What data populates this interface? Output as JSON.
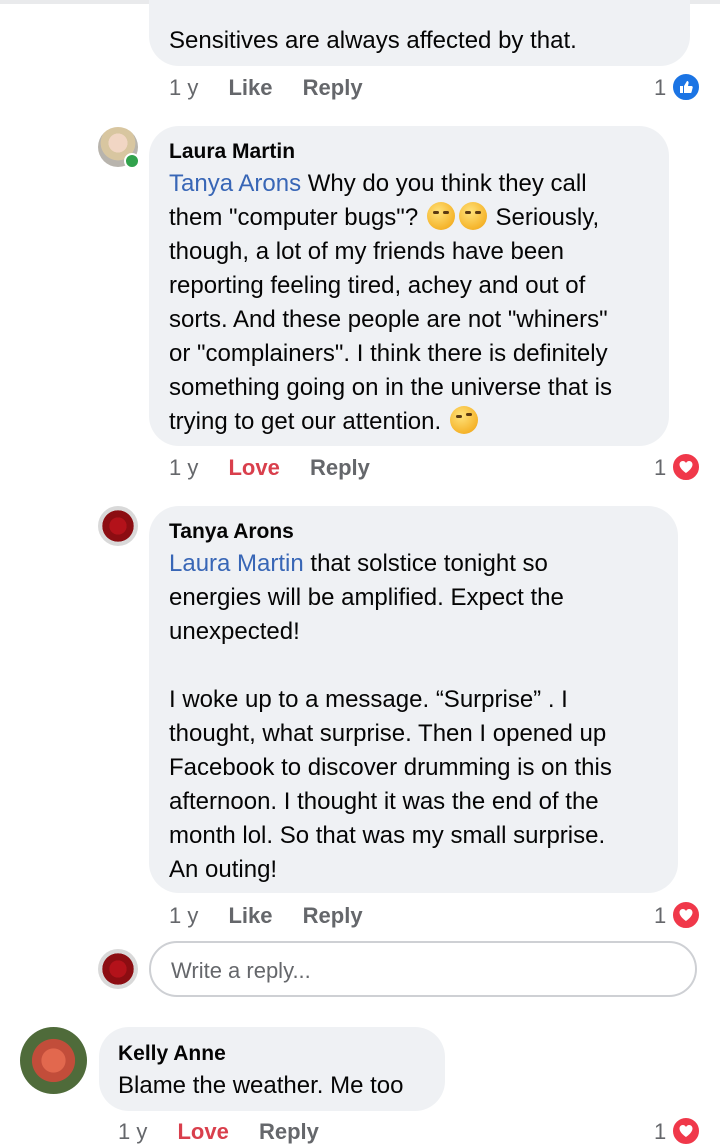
{
  "comments": [
    {
      "text": "Sensitives are always affected by that.",
      "time": "1 y",
      "action1": "Like",
      "action2": "Reply",
      "reaction_count": "1",
      "reaction_icon": "like-icon"
    },
    {
      "author": "Laura Martin",
      "mention": "Tanya Arons",
      "text_lines": [
        " Why do you think they call",
        "them \"computer bugs\"? ",
        "though, a lot of my friends have been",
        "reporting feeling tired, achey and out of",
        "sorts. And these people are not \"whiners\"",
        "or \"complainers\". I think there is definitely",
        "something going on in the universe that is",
        "trying to get our attention. "
      ],
      "after_emoji": " Seriously,",
      "time": "1 y",
      "action1": "Love",
      "action2": "Reply",
      "reaction_count": "1",
      "reaction_icon": "heart-icon"
    },
    {
      "author": "Tanya Arons",
      "mention": "Laura Martin",
      "text_lines": [
        " that solstice tonight so",
        "energies will be amplified.  Expect the",
        "unexpected!",
        "",
        "I woke up to a message.  “Surprise” .  I",
        "thought,  what surprise.  Then I opened up",
        "Facebook to discover drumming is on this",
        "afternoon.  I thought it was the end of the",
        "month lol.  So that was my small surprise.",
        "An outing!"
      ],
      "time": "1 y",
      "action1": "Like",
      "action2": "Reply",
      "reaction_count": "1",
      "reaction_icon": "heart-icon"
    },
    {
      "author": "Kelly Anne",
      "text": "Blame the weather. Me too",
      "time": "1 y",
      "action1": "Love",
      "action2": "Reply",
      "reaction_count": "1",
      "reaction_icon": "heart-icon"
    }
  ],
  "reply_input": {
    "placeholder": "Write a reply..."
  },
  "colors": {
    "mention": "#3866b6",
    "love": "#d93f4c",
    "bubble": "#eff1f4",
    "like_blue": "#1b74e4",
    "heart_red": "#f0384a"
  }
}
